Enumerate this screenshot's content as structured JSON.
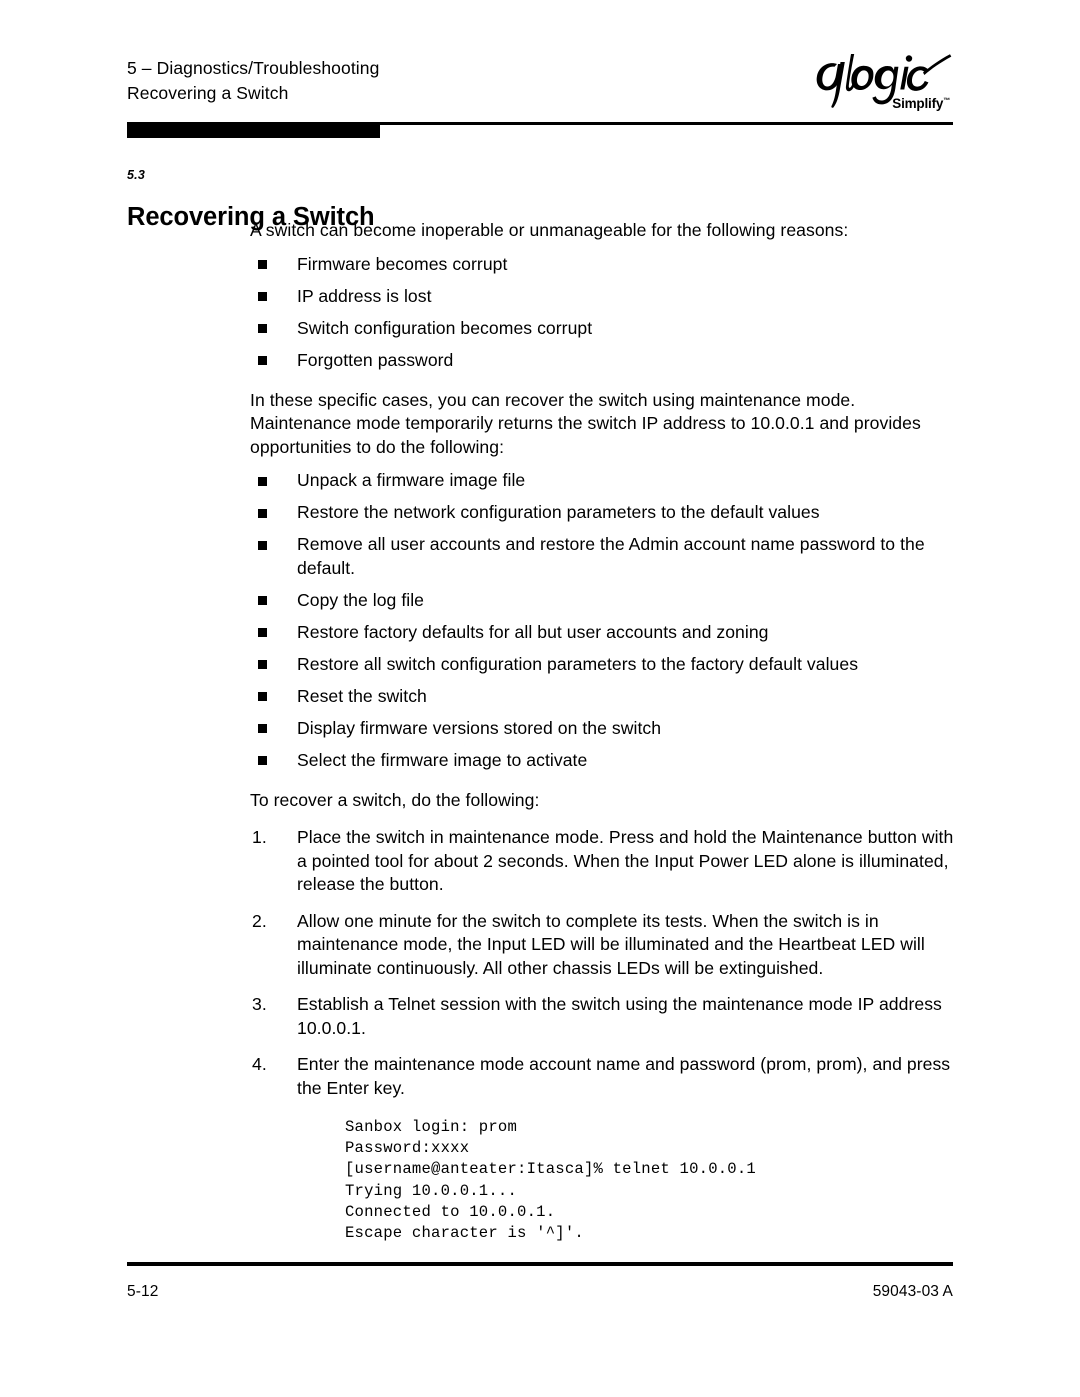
{
  "header": {
    "chapter_line": "5 – Diagnostics/Troubleshooting",
    "section_line": "Recovering a Switch",
    "logo_name": "qlogic",
    "logo_tagline": "Simplify",
    "logo_trademark": "™"
  },
  "section": {
    "number": "5.3",
    "title": "Recovering a Switch"
  },
  "intro": {
    "paragraph": "A switch can become inoperable or unmanageable for the following reasons:"
  },
  "reasons": [
    {
      "text": "Firmware becomes corrupt"
    },
    {
      "text": "IP address is lost"
    },
    {
      "text": "Switch configuration becomes corrupt"
    },
    {
      "text": "Forgotten password"
    }
  ],
  "maintenance": {
    "paragraph": "In these specific cases, you can recover the switch using maintenance mode. Maintenance mode temporarily returns the switch IP address to 10.0.0.1 and provides opportunities to do the following:"
  },
  "opportunities": [
    {
      "text": "Unpack a firmware image file"
    },
    {
      "text": "Restore the network configuration parameters to the default values"
    },
    {
      "text": "Remove all user accounts and restore the Admin account name password to the default."
    },
    {
      "text": "Copy the log file"
    },
    {
      "text": "Restore factory defaults for all but user accounts and zoning"
    },
    {
      "text": "Restore all switch configuration parameters to the factory default values"
    },
    {
      "text": "Reset the switch"
    },
    {
      "text": "Display firmware versions stored on the switch"
    },
    {
      "text": "Select the firmware image to activate"
    }
  ],
  "procedure_intro": {
    "paragraph": "To recover a switch, do the following:"
  },
  "steps": [
    {
      "number": "1.",
      "text": "Place the switch in maintenance mode. Press and hold the Maintenance button with a pointed tool for about 2 seconds. When the Input Power LED alone is illuminated, release the button."
    },
    {
      "number": "2.",
      "text": "Allow one minute for the switch to complete its tests. When the switch is in maintenance mode, the Input LED will be illuminated and the Heartbeat LED will illuminate continuously. All other chassis LEDs will be extinguished."
    },
    {
      "number": "3.",
      "text": "Establish a Telnet session with the switch using the maintenance mode IP address 10.0.0.1."
    },
    {
      "number": "4.",
      "text": "Enter the maintenance mode account name and password (prom, prom), and press the Enter key."
    }
  ],
  "terminal": {
    "content": "Sanbox login: prom\nPassword:xxxx\n[username@anteater:Itasca]% telnet 10.0.0.1\nTrying 10.0.0.1...\nConnected to 10.0.0.1.\nEscape character is '^]'."
  },
  "footer": {
    "page_number": "5-12",
    "document_number": "59043-03 A"
  }
}
